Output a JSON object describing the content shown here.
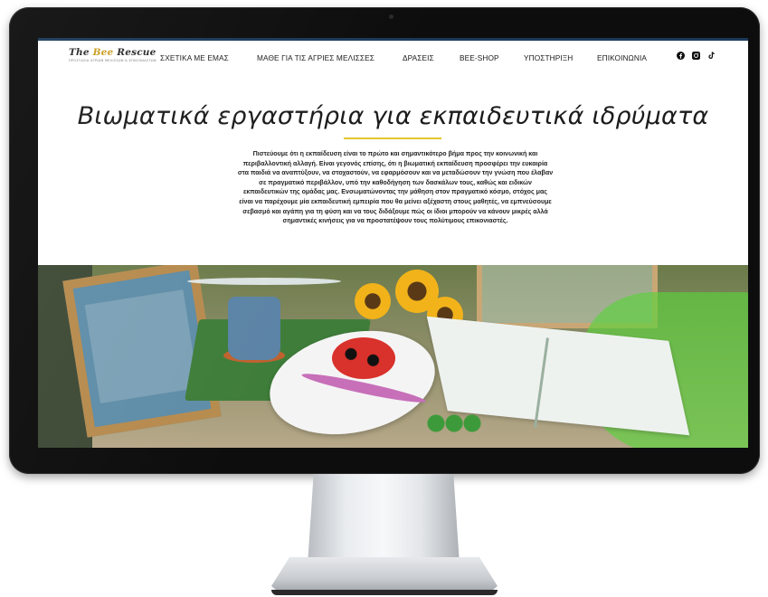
{
  "site": {
    "logo_text_part1": "The ",
    "logo_text_bee": "Bee",
    "logo_text_part2": " Rescue",
    "logo_tagline": "ΠΡΟΣΤΑΣΙΑ ΑΓΡΙΩΝ ΜΕΛΙΣΣΩΝ & ΕΠΙΚΟΝΙΑΣΤΩΝ"
  },
  "nav": {
    "items": [
      {
        "label": "ΣΧΕΤΙΚΑ ΜΕ ΕΜΑΣ"
      },
      {
        "label": "ΜΑΘΕ ΓΙΑ ΤΙΣ ΑΓΡΙΕΣ ΜΕΛΙΣΣΕΣ"
      },
      {
        "label": "ΔΡΑΣΕΙΣ"
      },
      {
        "label": "BEE-SHOP"
      },
      {
        "label": "ΥΠΟΣΤΗΡΙΞΗ"
      },
      {
        "label": "ΕΠΙΚΟΙΝΩΝΙΑ"
      }
    ],
    "socials": [
      "facebook-icon",
      "instagram-icon",
      "tiktok-icon"
    ]
  },
  "hero": {
    "title": "Βιωματικά εργαστήρια για εκπαιδευτικά ιδρύματα",
    "paragraph": "Πιστεύουμε ότι η εκπαίδευση είναι το πρώτο και σημαντικότερο βήμα προς την κοινωνική και περιβαλλοντική αλλαγή. Είναι γεγονός επίσης, ότι η βιωματική εκπαίδευση προσφέρει την ευκαιρία στα παιδιά να αναπτύξουν, να στοχαστούν, να εφαρμόσουν και να μεταδώσουν την γνώση που έλαβαν σε πραγματικό περιβάλλον, υπό την καθοδήγηση των δασκάλων τους, καθώς και ειδικών εκπαιδευτικών της ομάδας μας. Ενσωματώνοντας την μάθηση στον πραγματικό κόσμο, στόχος μας είναι να παρέχουμε μία εκπαιδευτική εμπειρία που θα μείνει αξέχαστη στους μαθητές, να εμπνεύσουμε σεβασμό και αγάπη για τη φύση και να τους διδάξουμε πώς οι ίδιοι μπορούν να κάνουν μικρές αλλά σημαντικές κινήσεις για να προστατέψουν τους πολύτιμους επικονιαστές."
  },
  "colors": {
    "accent_underline": "#e6c52c",
    "top_border": "#1c3a5b",
    "bezel": "#0d0d0d"
  }
}
